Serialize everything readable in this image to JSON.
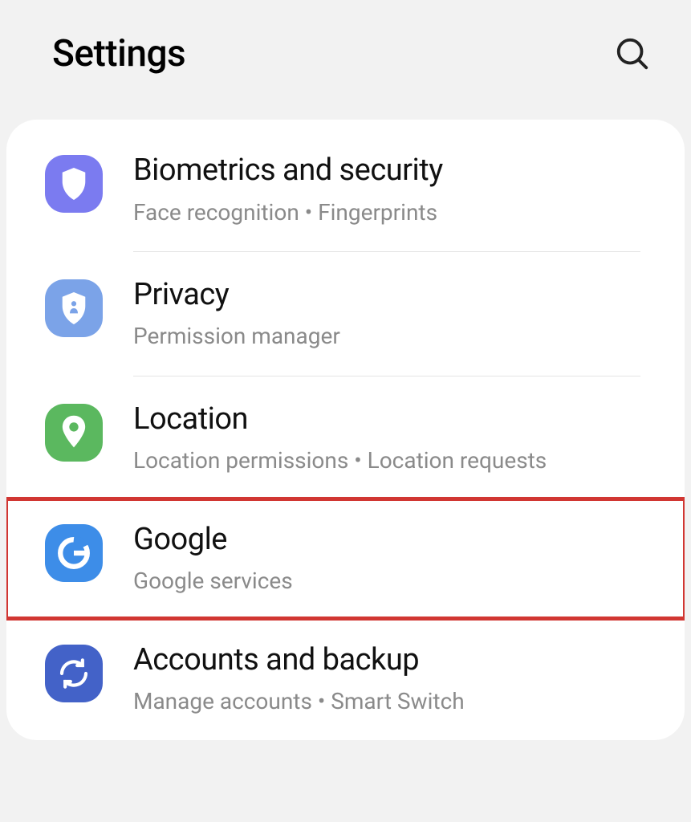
{
  "header": {
    "title": "Settings"
  },
  "items": [
    {
      "title": "Biometrics and security",
      "subtitle": "Face recognition  •  Fingerprints",
      "icon": "shield",
      "color": "purple"
    },
    {
      "title": "Privacy",
      "subtitle": "Permission manager",
      "icon": "privacy",
      "color": "lightblue"
    },
    {
      "title": "Location",
      "subtitle": "Location permissions  •  Location requests",
      "icon": "pin",
      "color": "green"
    },
    {
      "title": "Google",
      "subtitle": "Google services",
      "icon": "google",
      "color": "blue",
      "highlighted": true
    },
    {
      "title": "Accounts and backup",
      "subtitle": "Manage accounts  •  Smart Switch",
      "icon": "sync",
      "color": "navy"
    }
  ]
}
